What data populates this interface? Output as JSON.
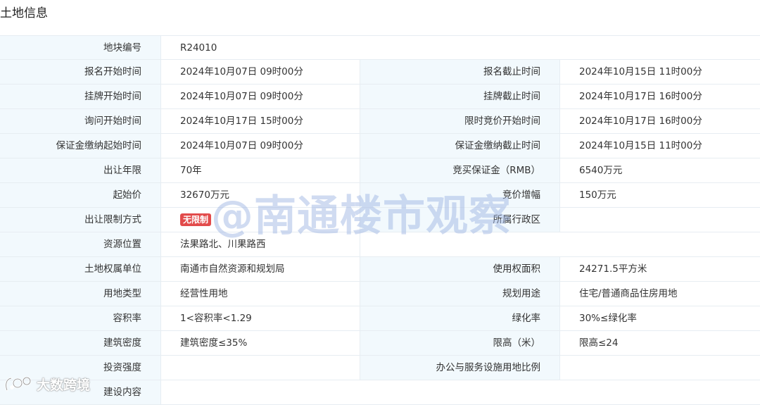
{
  "section": {
    "title": "土地信息"
  },
  "parcel": {
    "label": "地块编号",
    "value": "R24010"
  },
  "rows": [
    {
      "l1": "报名开始时间",
      "v1": "2024年10月07日 09时00分",
      "l2": "报名截止时间",
      "v2": "2024年10月15日 11时00分"
    },
    {
      "l1": "挂牌开始时间",
      "v1": "2024年10月07日 09时00分",
      "l2": "挂牌截止时间",
      "v2": "2024年10月17日 16时00分"
    },
    {
      "l1": "询问开始时间",
      "v1": "2024年10月17日 15时00分",
      "l2": "限时竞价开始时间",
      "v2": "2024年10月17日 16时00分"
    },
    {
      "l1": "保证金缴纳起始时间",
      "v1": "2024年10月07日 09时00分",
      "l2": "保证金缴纳截止时间",
      "v2": "2024年10月15日 11时00分"
    },
    {
      "l1": "出让年限",
      "v1": "70年",
      "l2": "竞买保证金（RMB）",
      "v2": "6540万元"
    },
    {
      "l1": "起始价",
      "v1": "32670万元",
      "l2": "竞价增幅",
      "v2": "150万元"
    },
    {
      "l1": "出让限制方式",
      "v1": "无限制",
      "l2": "所属行政区",
      "v2": ""
    },
    {
      "l1": "资源位置",
      "v1": "法果路北、川果路西",
      "l2": "",
      "v2": ""
    },
    {
      "l1": "土地权属单位",
      "v1": "南通市自然资源和规划局",
      "l2": "使用权面积",
      "v2": "24271.5平方米"
    },
    {
      "l1": "用地类型",
      "v1": "经营性用地",
      "l2": "规划用途",
      "v2": "住宅/普通商品住房用地"
    },
    {
      "l1": "容积率",
      "v1": "1<容积率<1.29",
      "l2": "绿化率",
      "v2": "30%≤绿化率"
    },
    {
      "l1": "建筑密度",
      "v1": "建筑密度≤35%",
      "l2": "限高（米）",
      "v2": "限高≤24"
    },
    {
      "l1": "投资强度",
      "v1": "",
      "l2": "办公与服务设施用地比例",
      "v2": ""
    }
  ],
  "last_row": {
    "label": "建设内容",
    "value": ""
  },
  "restriction_tag_color": "#e24b4b",
  "label_bg_color": "#f2f9fd",
  "watermark": {
    "text": "@南通楼市观察"
  },
  "brand": {
    "text": "大数跨境"
  }
}
